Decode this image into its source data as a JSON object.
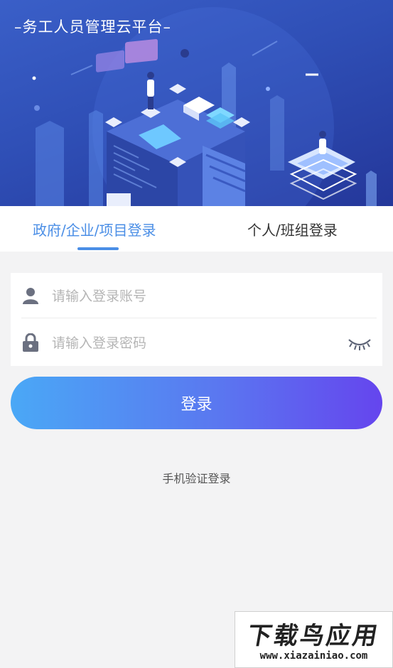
{
  "hero": {
    "title": "–务工人员管理云平台–",
    "illustration": "isometric-city-illustration"
  },
  "tabs": [
    {
      "label": "政府/企业/项目登录",
      "active": true
    },
    {
      "label": "个人/班组登录",
      "active": false
    }
  ],
  "form": {
    "account": {
      "placeholder": "请输入登录账号",
      "value": "",
      "icon": "user-icon"
    },
    "password": {
      "placeholder": "请输入登录密码",
      "value": "",
      "icon": "lock-icon",
      "toggle_icon": "eye-closed-icon"
    }
  },
  "login_button": {
    "label": "登录"
  },
  "sms_login": {
    "label": "手机验证登录"
  },
  "watermark": {
    "title": "下载鸟应用",
    "url": "www.xiazainiao.com"
  },
  "colors": {
    "accent": "#4a8ee6",
    "hero_bg": "#2f4fb6",
    "button_start": "#4aa8f6",
    "button_end": "#6545ee",
    "page_bg": "#f3f3f4"
  }
}
